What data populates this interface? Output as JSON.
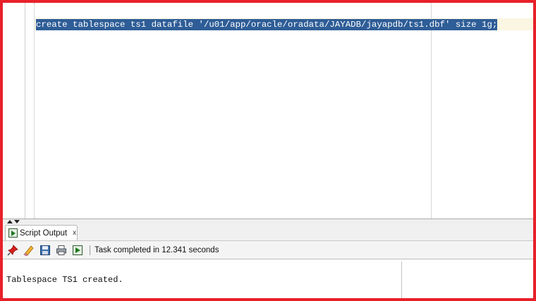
{
  "editor": {
    "code_line": "create tablespace ts1 datafile '/u01/app/oracle/oradata/JAYADB/jayapdb/ts1.dbf' size 1g;"
  },
  "output_panel": {
    "tab_label": "Script Output",
    "tab_close": "x",
    "status": "Task completed in 12.341 seconds",
    "result_text": "Tablespace TS1 created."
  },
  "toolbar_icons": [
    "pin-icon",
    "eraser-icon",
    "save-icon",
    "print-icon",
    "open-file-icon"
  ],
  "colors": {
    "selection": "#2e5d97",
    "current_line": "#fbf6e1",
    "frame_border": "#e8202a"
  }
}
